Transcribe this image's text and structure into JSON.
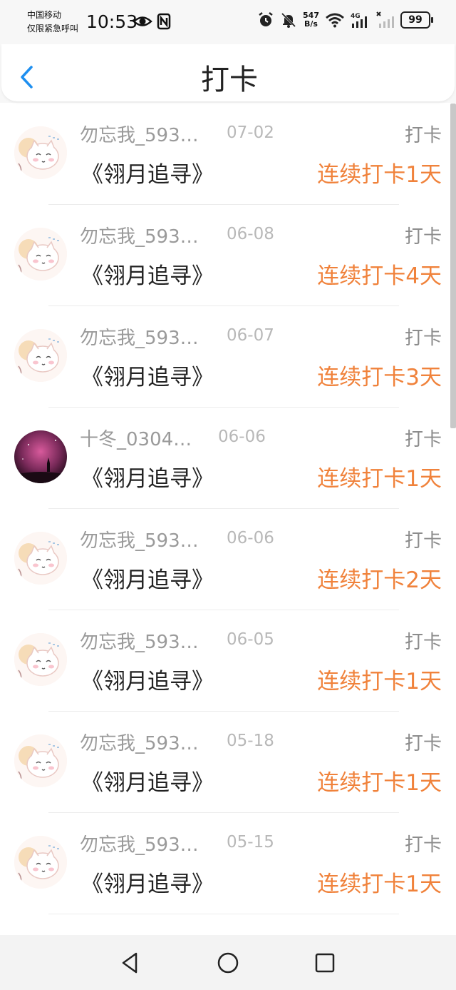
{
  "status_bar": {
    "carrier_line1": "中国移动",
    "carrier_line2": "仅限紧急呼叫",
    "time": "10:53",
    "net_speed_value": "547",
    "net_speed_unit": "B/s",
    "network_type": "4G",
    "battery": "99"
  },
  "header": {
    "title": "打卡",
    "back_icon": "chevron-left-icon"
  },
  "colors": {
    "accent": "#f0823b",
    "back": "#1e8ff0"
  },
  "records": [
    {
      "name": "勿忘我_593…",
      "date": "07-02",
      "type": "打卡",
      "book": "《翎月追寻》",
      "streak": "连续打卡1天",
      "avatar": "cat"
    },
    {
      "name": "勿忘我_593…",
      "date": "06-08",
      "type": "打卡",
      "book": "《翎月追寻》",
      "streak": "连续打卡4天",
      "avatar": "cat"
    },
    {
      "name": "勿忘我_593…",
      "date": "06-07",
      "type": "打卡",
      "book": "《翎月追寻》",
      "streak": "连续打卡3天",
      "avatar": "cat"
    },
    {
      "name": "十冬_0304…",
      "date": "06-06",
      "type": "打卡",
      "book": "《翎月追寻》",
      "streak": "连续打卡1天",
      "avatar": "moon"
    },
    {
      "name": "勿忘我_593…",
      "date": "06-06",
      "type": "打卡",
      "book": "《翎月追寻》",
      "streak": "连续打卡2天",
      "avatar": "cat"
    },
    {
      "name": "勿忘我_593…",
      "date": "06-05",
      "type": "打卡",
      "book": "《翎月追寻》",
      "streak": "连续打卡1天",
      "avatar": "cat"
    },
    {
      "name": "勿忘我_593…",
      "date": "05-18",
      "type": "打卡",
      "book": "《翎月追寻》",
      "streak": "连续打卡1天",
      "avatar": "cat"
    },
    {
      "name": "勿忘我_593…",
      "date": "05-15",
      "type": "打卡",
      "book": "《翎月追寻》",
      "streak": "连续打卡1天",
      "avatar": "cat"
    }
  ],
  "nav": {
    "back_icon": "triangle-back-icon",
    "home_icon": "circle-home-icon",
    "recents_icon": "square-recents-icon"
  }
}
